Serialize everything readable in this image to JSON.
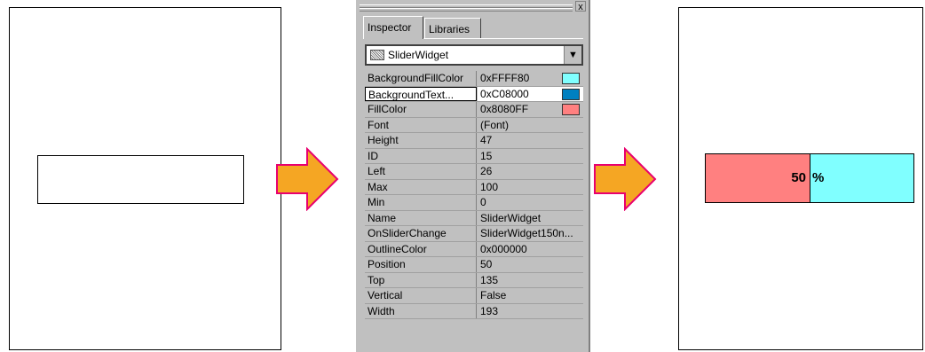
{
  "inspector": {
    "tabs": [
      "Inspector",
      "Libraries"
    ],
    "close_glyph": "x",
    "selected_object": "SliderWidget",
    "properties": [
      {
        "name": "BackgroundFillColor",
        "value": "0xFFFF80",
        "swatch": "#80ffff"
      },
      {
        "name": "BackgroundText...",
        "value": "0xC08000",
        "swatch": "#0080c0",
        "selected": true
      },
      {
        "name": "FillColor",
        "value": "0x8080FF",
        "swatch": "#ff8080"
      },
      {
        "name": "Font",
        "value": "(Font)"
      },
      {
        "name": "Height",
        "value": "47"
      },
      {
        "name": "ID",
        "value": "15"
      },
      {
        "name": "Left",
        "value": "26"
      },
      {
        "name": "Max",
        "value": "100"
      },
      {
        "name": "Min",
        "value": "0"
      },
      {
        "name": "Name",
        "value": "SliderWidget"
      },
      {
        "name": "OnSliderChange",
        "value": "SliderWidget150n..."
      },
      {
        "name": "OutlineColor",
        "value": "0x000000"
      },
      {
        "name": "Position",
        "value": "50"
      },
      {
        "name": "Top",
        "value": "135"
      },
      {
        "name": "Vertical",
        "value": "False"
      },
      {
        "name": "Width",
        "value": "193"
      }
    ]
  },
  "slider_preview": {
    "value_text": "50",
    "unit_text": "%",
    "fill_fraction": 0.5,
    "fill_color": "#ff8080",
    "background_color": "#80ffff"
  },
  "colors": {
    "arrow_fill": "#f5a623",
    "arrow_stroke": "#e8006e"
  }
}
